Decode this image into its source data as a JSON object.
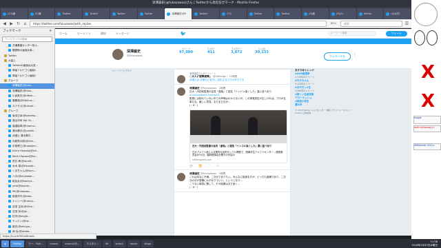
{
  "window": {
    "title": "深澤諭史(@fukazawas)さん | Twitterから高信任ガマーク - Mozilla Firefox"
  },
  "tabs": [
    "(12)通",
    "(5)通",
    "Twitter",
    "Twitter",
    "Twitter",
    "Twitter",
    "深澤諭史(@f",
    "Twitter",
    "パス",
    "Twitter",
    "Twitter",
    "(5)通",
    "(3)(0)",
    "Twitter",
    "(4)大切"
  ],
  "nav": {
    "url": "https://twitter.com/fukazawas/with_replies",
    "search": "検索",
    "zoom": "80%"
  },
  "sidebar": {
    "header": "ブックマーク",
    "search_placeholder": "ブックマークの検索",
    "items": [
      "共通基盤センター前人...",
      "履歴時の画面大事...",
      "Twitter",
      "大量上",
      "Twitterの画面は大変...",
      "準組↑カテゴリ画面1",
      "準組↑カテゴリ画面2",
      "グループ",
      "深澤諭史(@fuka...",
      "深澤諭史(@fuka...",
      "小倉秀夫(@hfbok...",
      "喜義達(@kfjkhus...",
      "ネクサス(@ukiuhi...",
      "グループ",
      "坂本正幸(@sakamo...",
      "落合洋司 Yoji Oc...",
      "高橋裕章(@hiromu...",
      "清水陽平(@yoheik...",
      "弁護士 清水陽平...",
      "向原栄大郎(@mkt...",
      "中島博之(@nakajim...",
      "Ichiro Hiraoka(@ich...",
      "Koichi Egawa(@ko...",
      "荒井 孝(@iaraiit...",
      "木木 菜(@kinasak...",
      "くまちゃん(@kum...",
      "ハタ(@kh2ewbe...",
      "紙谷太(@kamiyt...",
      "ymt(@loverm...",
      "Pfi(@hirobass...",
      "雨宮洋平(@ame...",
      "ナンシー(@nancy...",
      "吉田 正弁(@t2ho...",
      "吉田 奈(@jpl...",
      "紅牙(@akgib...",
      "ティエン(@tw...",
      "新庄(@shinjyo...",
      "岡 功(@okada...",
      "鈴木直(@suzuki...",
      "土屋壮(@tsuchi...",
      "鈴木清司(@siro..."
    ],
    "selected_index": 8
  },
  "twitter": {
    "nav": [
      "ホーム",
      "モーメント",
      "通知",
      "メッセージ"
    ],
    "search": "キーワード検索",
    "tweet_button": "ツイート",
    "name": "深澤諭史",
    "handle": "@fukazawas",
    "stats": [
      {
        "label": "ツイート",
        "value": "97,000"
      },
      {
        "label": "フォロー",
        "value": "411"
      },
      {
        "label": "フォロワー",
        "value": "3,872"
      },
      {
        "label": "いいね",
        "value": "30,133"
      }
    ],
    "follow_button": "フォローする",
    "left_note": "ツイートとリプライ",
    "tweets": [
      {
        "rt": "深澤諭史さんがリツイート",
        "name": "○大人(「疲弊疲弊」",
        "meta": "@hiktsdgn · 11時間",
        "text": "弁護士は 法律など多方に当然 正当です大好きです。"
      },
      {
        "name": "深澤諭史",
        "meta": "@fukazawas · 2時間",
        "text": "日大・内田前監督の会見「虚偽」と認定「ドンドン強くした」違い並べあり",
        "link": "a.nikkansports.com/w/f5...",
        "text2": "監督には知れていない中での声明はわからないが、この事実認定が正しければ、プロの仕事だな。厳しい意見。まだまだ日が…",
        "action": "(・∀・)"
      },
      {
        "name": "深澤諭史",
        "meta": "@fukazawas · 2時間",
        "text": "これは本当に不満。二次元でありたい。みんなに挨拶ますが、どっちも虚構であり、二次元の分が虚構にわかなりでいい。というとなり…",
        "text2": "こうない事態に関して、その結果はまだ深く…",
        "action": "(・∀・)"
      }
    ],
    "card": {
      "title": "日大・内田前監督の会見「虚偽」と認定「インコル強くした」違い並べあり",
      "body": "日大アメフト部による悪質な反則タックル問題で、関東学生アメフトセンター…調査委員会が29日、臨時理事会を開きの内容の",
      "domain": "nikkansports.com"
    },
    "right": {
      "trends_title": "おすすめトレンド",
      "trends": [
        "#AKB総選挙",
        "#モネちゃん",
        "#ボギモン2日",
        "#新しい生産技術",
        "アローラッシュ",
        "#鉄道小学生",
        "濃水平"
      ],
      "trend_sub": [
        "2,316件のツイート",
        "3,120件のツイート",
        "1,580件のツイート"
      ],
      "footer": "© 2018 Twitter  ヘルプセンター  規約  プライバシーポリシー  Cookie  広告情報"
    }
  },
  "status_url": "https://t.co/b78Ciw8meks",
  "taskbar": {
    "items": [
      "Firefox",
      "ウー・Troll...",
      "emacs",
      "emacs2@...",
      "ホスタジ...",
      "lfk",
      "xclock",
      "xeyes",
      "sfogo"
    ],
    "active_index": 0,
    "time": "11:38",
    "date": "2018年5月30日水曜日"
  },
  "desktop": {
    "note1": "kaggle",
    "note2": "sodi-myitpsnsg.x.f",
    "note3": "WWW/stab-2019.x"
  }
}
